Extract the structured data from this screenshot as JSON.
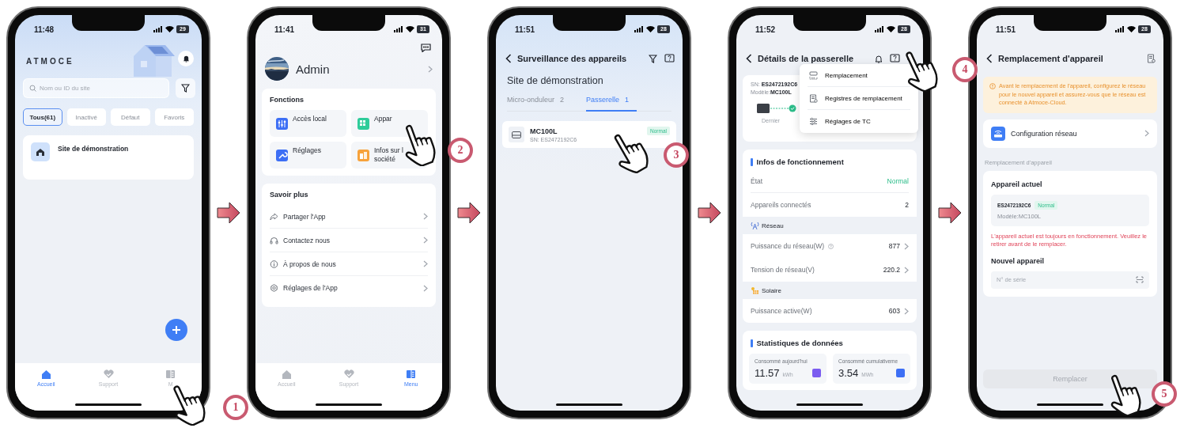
{
  "screens": [
    {
      "kind": "home",
      "step": "1",
      "time": "11:48",
      "battery": "29",
      "brand": "ATMOCE",
      "search": {
        "placeholder": "Nom ou ID du site"
      },
      "filters": [
        {
          "label": "Tous(61)",
          "selected": true
        },
        {
          "label": "Inactivé",
          "selected": false
        },
        {
          "label": "Défaut",
          "selected": false
        },
        {
          "label": "Favoris",
          "selected": false
        }
      ],
      "sites": [
        {
          "name": "Site de démonstration"
        }
      ],
      "tabbar": [
        {
          "label": "Accueil",
          "selected": true
        },
        {
          "label": "Support",
          "selected": false
        },
        {
          "label": "M",
          "selected": false
        }
      ]
    },
    {
      "kind": "menu",
      "step": "2",
      "time": "11:41",
      "battery": "31",
      "user": "Admin",
      "functions": {
        "title": "Fonctions",
        "tiles": [
          {
            "label": "Accès local",
            "color": "#3d6ff5"
          },
          {
            "label": "Appar",
            "color": "#2fcc9a"
          },
          {
            "label": "Réglages",
            "color": "#3d6ff5"
          },
          {
            "label": "Infos sur l\nsociété",
            "color": "#f7a23b"
          }
        ]
      },
      "more": {
        "title": "Savoir plus",
        "items": [
          {
            "label": "Partager l'App"
          },
          {
            "label": "Contactez nous"
          },
          {
            "label": "À propos de nous"
          },
          {
            "label": "Réglages de l'App"
          }
        ]
      },
      "tabbar": [
        {
          "label": "Accueil",
          "selected": false
        },
        {
          "label": "Support",
          "selected": false
        },
        {
          "label": "Menu",
          "selected": true
        }
      ]
    },
    {
      "kind": "devices",
      "step": "3",
      "time": "11:51",
      "battery": "28",
      "title": "Surveillance des appareils",
      "site": "Site de démonstration",
      "tabs": [
        {
          "label": "Micro-onduleur",
          "count": "2",
          "selected": false
        },
        {
          "label": "Passerelle",
          "count": "1",
          "selected": true
        }
      ],
      "devices": [
        {
          "name": "MC100L",
          "serial": "SN: ES2472192C6",
          "status": "Normal"
        }
      ]
    },
    {
      "kind": "details",
      "step": "4",
      "time": "11:52",
      "battery": "28",
      "title": "Détails de la passerelle",
      "summary": {
        "sn_label": "SN:",
        "sn": "ES2472192C6",
        "model_label": "Modèle:",
        "model": "MC100L",
        "report": "Dernier"
      },
      "menu": [
        {
          "label": "Remplacement"
        },
        {
          "label": "Registres de remplacement"
        },
        {
          "label": "Réglages de TC"
        }
      ],
      "info": {
        "title": "Infos de fonctionnement",
        "rows": [
          {
            "label": "État",
            "value": "Normal",
            "kind": "status",
            "help": false
          },
          {
            "label": "Appareils connectés",
            "value": "2",
            "kind": "plain",
            "help": false
          }
        ],
        "groups": [
          {
            "title": "Réseau",
            "rows": [
              {
                "label": "Puissance du réseau(W)",
                "value": "877",
                "kind": "link",
                "help": true
              },
              {
                "label": "Tension de réseau(V)",
                "value": "220.2",
                "kind": "link",
                "help": false
              }
            ]
          },
          {
            "title": "Solaire",
            "rows": [
              {
                "label": "Puissance active(W)",
                "value": "603",
                "kind": "link",
                "help": false
              }
            ]
          }
        ]
      },
      "stats": {
        "title": "Statistiques de données",
        "tiles": [
          {
            "label": "Consommé aujourd'hui",
            "value": "11.57",
            "unit": "kWh",
            "color": "#7b5cf0"
          },
          {
            "label": "Consommé cumulativeme",
            "value": "3.54",
            "unit": "MWh",
            "color": "#3d6ff5"
          }
        ]
      }
    },
    {
      "kind": "replace",
      "step": "5",
      "time": "11:51",
      "battery": "28",
      "title": "Remplacement d'appareil",
      "notice": "Avant le remplacement de l'appareil, configurez le réseau pour le nouvel appareil et assurez-vous que le réseau est connecté à Atmoce-Cloud.",
      "network": "Configuration réseau",
      "section": "Remplacement d'appareil",
      "current": {
        "title": "Appareil actuel",
        "serial": "ES2472192C6",
        "status": "Normal",
        "model": "Modèle:MC100L",
        "warning": "L'appareil actuel est toujours en fonctionnement. Veuillez le retirer avant de le remplacer."
      },
      "new": {
        "title": "Nouvel appareil",
        "placeholder": "N° de série"
      },
      "button": {
        "label": "Remplacer",
        "disabled": true
      }
    }
  ]
}
